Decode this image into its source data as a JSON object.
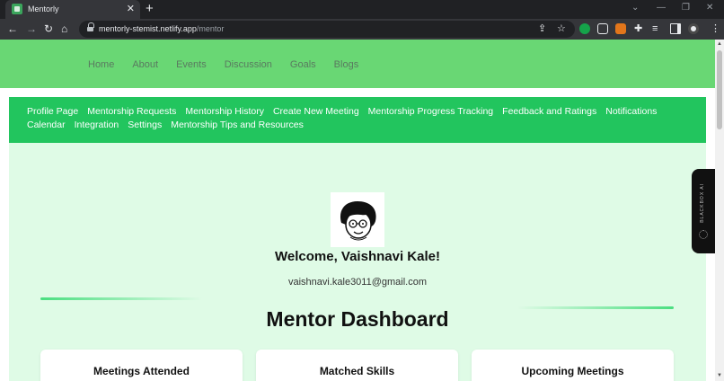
{
  "browser": {
    "tab_title": "Mentorly",
    "tab_close": "✕",
    "new_tab": "+",
    "url_host": "mentorly-stemist.netlify.app",
    "url_path": "/mentor",
    "colors": {
      "tab_bg": "#35363a",
      "frame_bg": "#202124"
    }
  },
  "site": {
    "nav": [
      "Home",
      "About",
      "Events",
      "Discussion",
      "Goals",
      "Blogs"
    ],
    "colors": {
      "header": "#69d774",
      "subnav": "#22c55e",
      "content": "#dffbe6"
    }
  },
  "mentor_nav": [
    "Profile Page",
    "Mentorship Requests",
    "Mentorship History",
    "Create New Meeting",
    "Mentorship Progress Tracking",
    "Feedback and Ratings",
    "Notifications",
    "Calendar",
    "Integration",
    "Settings",
    "Mentorship Tips and Resources"
  ],
  "profile": {
    "welcome": "Welcome, Vaishnavi Kale!",
    "email": "vaishnavi.kale3011@gmail.com"
  },
  "dashboard": {
    "title": "Mentor Dashboard",
    "cards": [
      "Meetings Attended",
      "Matched Skills",
      "Upcoming Meetings"
    ]
  },
  "blackbox": {
    "label": "BLACKBOX AI"
  }
}
